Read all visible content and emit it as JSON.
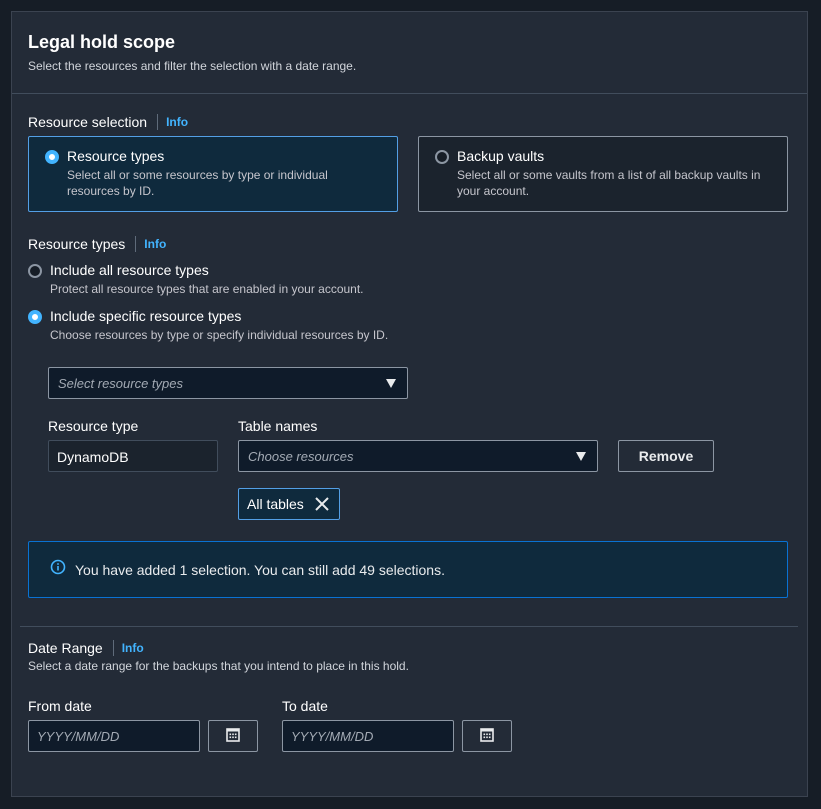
{
  "header": {
    "title": "Legal hold scope",
    "description": "Select the resources and filter the selection with a date range."
  },
  "resource_selection": {
    "label": "Resource selection",
    "info": "Info",
    "options": [
      {
        "title": "Resource types",
        "description_line1": "Select all or some resources by type or individual",
        "description_line2": "resources by ID.",
        "selected": true
      },
      {
        "title": "Backup vaults",
        "description_line1": "Select all or some vaults from a list of all backup vaults in",
        "description_line2": "your account.",
        "selected": false
      }
    ]
  },
  "resource_types": {
    "label": "Resource types",
    "info": "Info",
    "options": [
      {
        "title": "Include all resource types",
        "description": "Protect all resource types that are enabled in your account.",
        "selected": false
      },
      {
        "title": "Include specific resource types",
        "description": "Choose resources by type or specify individual resources by ID.",
        "selected": true
      }
    ],
    "select_placeholder": "Select resource types"
  },
  "resource_row": {
    "type_label": "Resource type",
    "type_value": "DynamoDB",
    "names_label": "Table names",
    "names_placeholder": "Choose resources",
    "remove_label": "Remove",
    "token_label": "All tables"
  },
  "alert": {
    "text": "You have added 1 selection. You can still add 49 selections."
  },
  "date_range": {
    "label": "Date Range",
    "info": "Info",
    "description": "Select a date range for the backups that you intend to place in this hold.",
    "from_label": "From date",
    "from_placeholder": "YYYY/MM/DD",
    "to_label": "To date",
    "to_placeholder": "YYYY/MM/DD"
  },
  "icons": {
    "radio": "radio-icon",
    "caret": "caret-down-icon",
    "dismiss": "close-icon",
    "info": "info-circle-icon",
    "calendar": "calendar-icon"
  },
  "colors": {
    "accent": "#42b4ff",
    "selected_border": "#539fe5",
    "alert_border": "#0972d3",
    "panel_bg": "#232b37"
  }
}
